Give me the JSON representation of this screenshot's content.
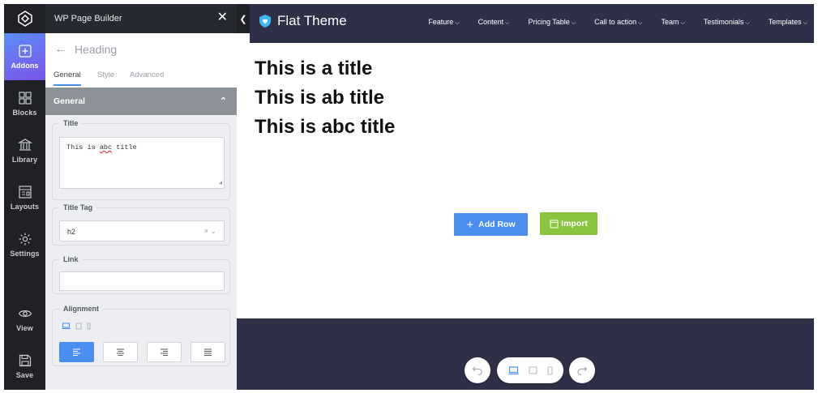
{
  "rail": {
    "items": [
      {
        "label": "Addons",
        "icon": "plus-square-icon"
      },
      {
        "label": "Blocks",
        "icon": "blocks-icon"
      },
      {
        "label": "Library",
        "icon": "library-icon"
      },
      {
        "label": "Layouts",
        "icon": "layouts-icon"
      },
      {
        "label": "Settings",
        "icon": "gear-icon"
      },
      {
        "label": "View",
        "icon": "eye-icon"
      },
      {
        "label": "Save",
        "icon": "save-icon"
      }
    ]
  },
  "panel": {
    "title": "WP Page Builder",
    "close": "✕",
    "back_label": "Heading",
    "tabs": [
      "General",
      "Style",
      "Advanced"
    ],
    "group": "General",
    "title_field": {
      "label": "Title",
      "value_pre": "This is ",
      "value_err": "abc",
      "value_post": " title"
    },
    "tag_field": {
      "label": "Title Tag",
      "value": "h2",
      "controls": "× ⌄"
    },
    "link_field": {
      "label": "Link",
      "value": ""
    },
    "alignment": {
      "label": "Alignment"
    }
  },
  "site": {
    "brand": "Flat Theme",
    "menu": [
      "Feature",
      "Content",
      "Pricing Table",
      "Call to action",
      "Team",
      "Testimonials",
      "Templates"
    ]
  },
  "canvas": {
    "titles": [
      "This is a title",
      "This is ab title",
      "This is abc title"
    ],
    "add_row": "Add Row",
    "import": "Import"
  },
  "colors": {
    "accent": "#4a8ff0",
    "import_green": "#8bc53f",
    "dark_nav": "#2d3046",
    "rail": "#1f2127"
  }
}
